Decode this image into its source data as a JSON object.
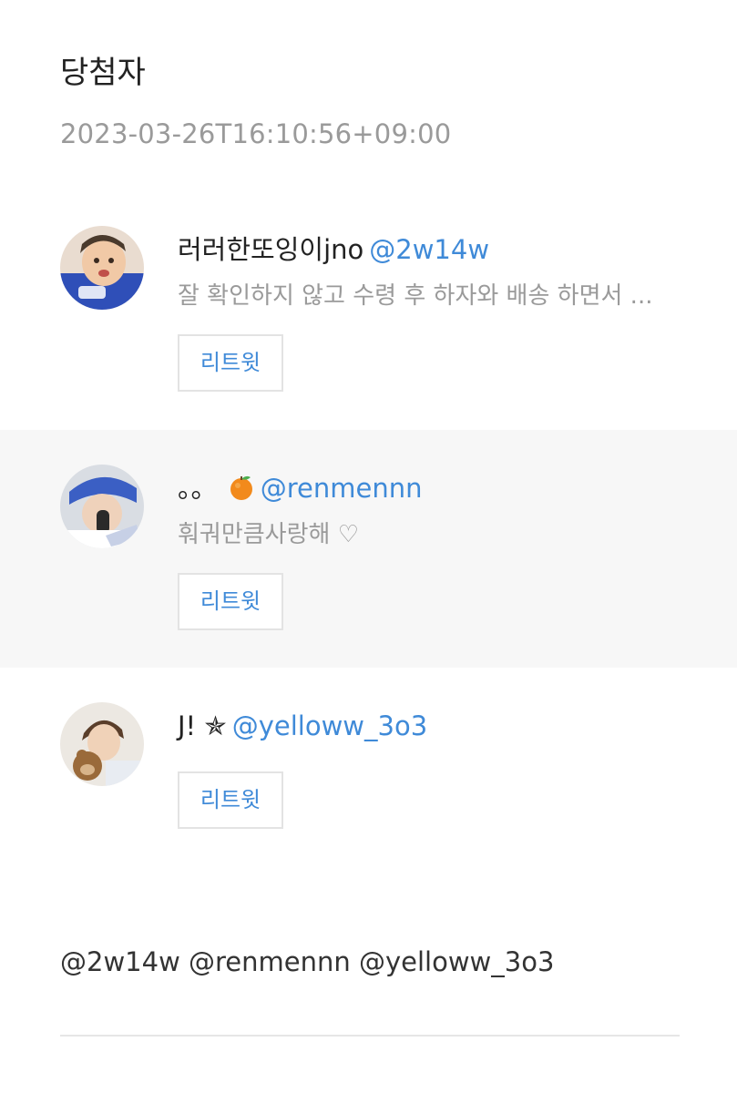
{
  "header": {
    "title": "당첨자",
    "timestamp": "2023-03-26T16:10:56+09:00"
  },
  "winners": [
    {
      "display_name": "러러한또잉이jno",
      "handle": "@2w14w",
      "description": "잘 확인하지 않고 수령 후 하자와 배송 하면서 ...",
      "retweet_label": "리트윗"
    },
    {
      "display_name": "。。",
      "name_emoji": "orange-emoji-icon",
      "handle": "@renmennn",
      "description": "훠궈만큼사랑해 ♡",
      "retweet_label": "리트윗"
    },
    {
      "display_name": "J! ✯",
      "handle": "@yelloww_3o3",
      "retweet_label": "리트윗"
    }
  ],
  "footer": {
    "mentions": "@2w14w @renmennn @yelloww_3o3"
  },
  "colors": {
    "link": "#3f8ad8",
    "muted": "#9a9a9a",
    "highlight_row": "#f7f7f7"
  }
}
